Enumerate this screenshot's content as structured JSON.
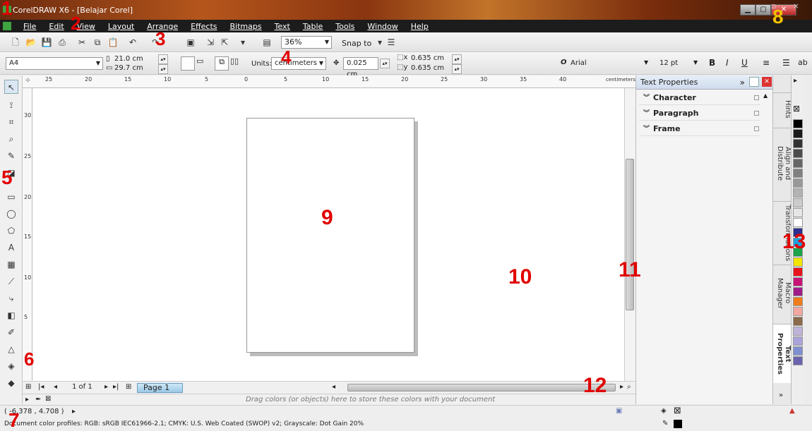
{
  "app": {
    "title": "CorelDRAW X6 - [Belajar Corel]"
  },
  "menu": [
    "File",
    "Edit",
    "View",
    "Layout",
    "Arrange",
    "Effects",
    "Bitmaps",
    "Text",
    "Table",
    "Tools",
    "Window",
    "Help"
  ],
  "toolbar": {
    "zoom": "36%",
    "snap_label": "Snap to"
  },
  "property_bar": {
    "paper": "A4",
    "width": "21.0 cm",
    "height": "29.7 cm",
    "units_label": "Units:",
    "units_value": "centimeters",
    "nudge": "0.025 cm",
    "dup_x": "0.635 cm",
    "dup_y": "0.635 cm",
    "font": "Arial",
    "font_size": "12 pt"
  },
  "ruler": {
    "h_labels": [
      "25",
      "20",
      "15",
      "10",
      "5",
      "0",
      "5",
      "10",
      "15",
      "20",
      "25",
      "30",
      "35",
      "40"
    ],
    "v_labels": [
      "30",
      "25",
      "20",
      "15",
      "10",
      "5"
    ],
    "unit": "centimeters"
  },
  "page_nav": {
    "count": "1 of 1",
    "tab": "Page 1"
  },
  "color_bar": {
    "hint": "Drag colors (or objects) here to store these colors with your document"
  },
  "status": {
    "coords": "( -6.378 , 4.708 )",
    "profile": "Document color profiles: RGB: sRGB IEC61966-2.1; CMYK: U.S. Web Coated (SWOP) v2; Grayscale: Dot Gain 20%"
  },
  "docker": {
    "title": "Text Properties",
    "sections": [
      "Character",
      "Paragraph",
      "Frame"
    ],
    "tabs": [
      "Hints",
      "Align and Distribute",
      "Transformations",
      "Macro Manager",
      "Text Properties"
    ]
  },
  "palette": [
    "#000000",
    "#1a1a1a",
    "#333333",
    "#4d4d4d",
    "#666666",
    "#808080",
    "#999999",
    "#b3b3b3",
    "#cccccc",
    "#e6e6e6",
    "#ffffff",
    "#2b2f8f",
    "#1aa0e0",
    "#1ea24a",
    "#f2e500",
    "#e8141c",
    "#c81477",
    "#a01c8a",
    "#ef7d1a",
    "#f4a7a0",
    "#8a6a4a",
    "#bfb3d9",
    "#a8a3d8",
    "#7f8fd0",
    "#6a63b0"
  ],
  "annotations": [
    "1",
    "2",
    "3",
    "4",
    "5",
    "6",
    "7",
    "8",
    "9",
    "10",
    "11",
    "12",
    "13"
  ]
}
